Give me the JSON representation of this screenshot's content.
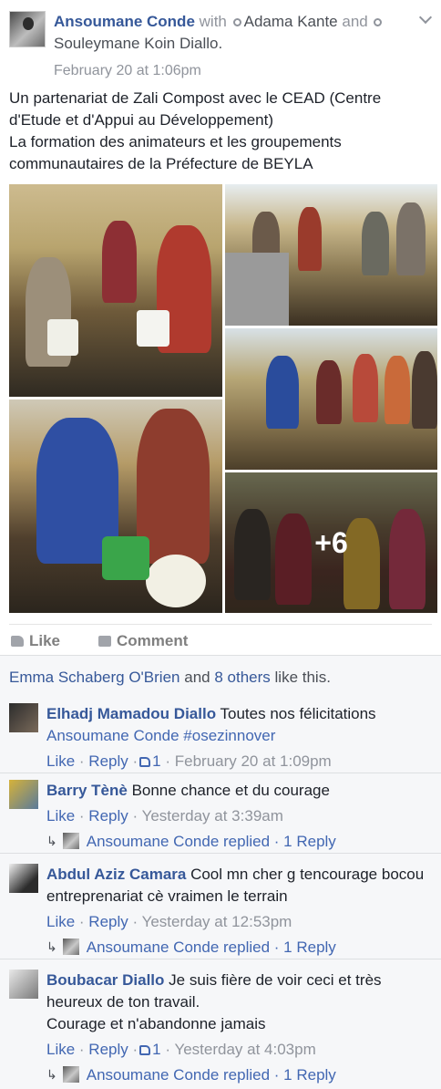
{
  "post": {
    "author": "Ansoumane Conde",
    "with_word": "with",
    "tagged_1": "Adama Kante",
    "and_word": "and",
    "tagged_2": "Souleymane Koin Diallo.",
    "timestamp": "February 20 at 1:06pm",
    "text_line_1": "Un partenariat de Zali Compost avec le CEAD (Centre d'Etude et d'Appui au Développement)",
    "text_line_2": "La formation des animateurs et les groupements communautaires de la Préfecture de BEYLA",
    "more_photos": "+6"
  },
  "actions": {
    "like_label": "Like",
    "comment_label": "Comment"
  },
  "likes": {
    "first_liker": "Emma Schaberg O'Brien",
    "and_word": "and",
    "others": "8 others",
    "suffix": "like this."
  },
  "comments": [
    {
      "name": "Elhadj Mamadou Diallo",
      "text": "Toutes nos félicitations",
      "mention": "Ansoumane Conde",
      "hashtag": "#osezinnover",
      "like": "Like",
      "reply": "Reply",
      "like_count": "1",
      "time": "February 20 at 1:09pm"
    },
    {
      "name": "Barry Tènè",
      "text": "Bonne chance et du courage",
      "like": "Like",
      "reply": "Reply",
      "time": "Yesterday at 3:39am",
      "replied_by": "Ansoumane Conde replied",
      "reply_count": "1 Reply"
    },
    {
      "name": "Abdul Aziz Camara",
      "text": "Cool mn cher g tencourage bocou entreprenariat cè vraimen le terrain",
      "like": "Like",
      "reply": "Reply",
      "time": "Yesterday at 12:53pm",
      "replied_by": "Ansoumane Conde replied",
      "reply_count": "1 Reply"
    },
    {
      "name": "Boubacar Diallo",
      "text": "Je suis fière de voir ceci et très heureux de ton travail.",
      "text_2": "Courage et n'abandonne jamais",
      "like": "Like",
      "reply": "Reply",
      "like_count": "1",
      "time": "Yesterday at 4:03pm",
      "replied_by": "Ansoumane Conde replied",
      "reply_count": "1 Reply"
    }
  ],
  "colors": {
    "link": "#365899",
    "meta": "#90949c",
    "feedback_bg": "#f6f7f9"
  }
}
